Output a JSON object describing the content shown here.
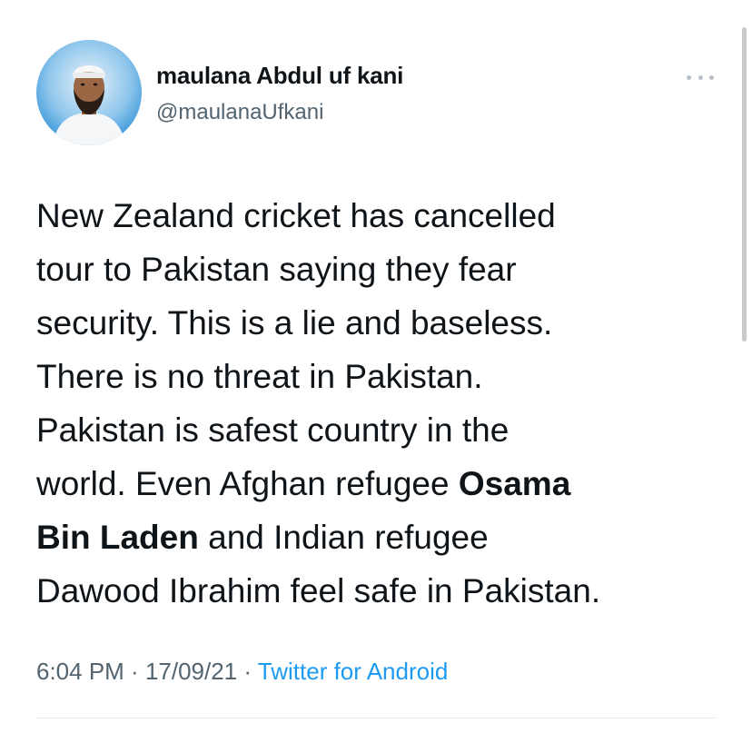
{
  "tweet": {
    "user": {
      "display_name": "maulana Abdul uf kani",
      "handle": "@maulanaUfkani",
      "avatar_icon": "profile-photo-avatar"
    },
    "more_icon": "more-options-icon",
    "text_lines": {
      "l1": "New Zealand cricket has cancelled",
      "l2": "tour to Pakistan saying they fear",
      "l3": "security. This is a lie and baseless.",
      "l4": "There is no threat in Pakistan.",
      "l5": "Pakistan is safest country in the",
      "l6a": "world. Even Afghan refugee ",
      "l6b": "Osama",
      "l7a": "Bin Laden",
      "l7b": " and Indian refugee",
      "l8": "Dawood Ibrahim feel safe in Pakistan."
    },
    "meta": {
      "time": "6:04 PM",
      "separator": " · ",
      "date": "17/09/21",
      "separator2": " · ",
      "source": "Twitter for Android"
    }
  },
  "colors": {
    "text": "#0f1419",
    "secondary": "#536471",
    "link": "#1d9bf0"
  }
}
